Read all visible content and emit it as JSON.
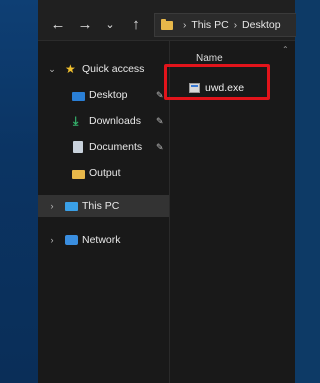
{
  "toolbar": {
    "back_icon": "arrow-left-icon",
    "forward_icon": "arrow-right-icon",
    "recent_icon": "chevron-down-icon",
    "up_icon": "arrow-up-icon",
    "back_glyph": "←",
    "forward_glyph": "→",
    "recent_glyph": "⌄",
    "up_glyph": "↑"
  },
  "address": {
    "segments": [
      "This PC",
      "Desktop"
    ],
    "separator": "›"
  },
  "sidebar": {
    "quick_access": {
      "label": "Quick access",
      "chevron": "⌄",
      "icon": "star-icon"
    },
    "items": [
      {
        "label": "Desktop",
        "icon": "desktop-icon",
        "pinned": true
      },
      {
        "label": "Downloads",
        "icon": "downloads-icon",
        "pinned": true
      },
      {
        "label": "Documents",
        "icon": "documents-icon",
        "pinned": true
      },
      {
        "label": "Output",
        "icon": "folder-icon",
        "pinned": false
      }
    ],
    "this_pc": {
      "label": "This PC",
      "chevron": "›",
      "icon": "pc-icon",
      "selected": true
    },
    "network": {
      "label": "Network",
      "chevron": "›",
      "icon": "network-icon"
    },
    "pin_glyph": "📌"
  },
  "content": {
    "column_header": "Name",
    "sort_glyph": "⌃",
    "files": [
      {
        "name": "uwd.exe",
        "icon": "exe-icon"
      }
    ]
  },
  "colors": {
    "highlight": "#e2141b",
    "folder": "#e8b84a",
    "star": "#f2c12e",
    "background": "#191919",
    "selected_row": "#333333"
  }
}
